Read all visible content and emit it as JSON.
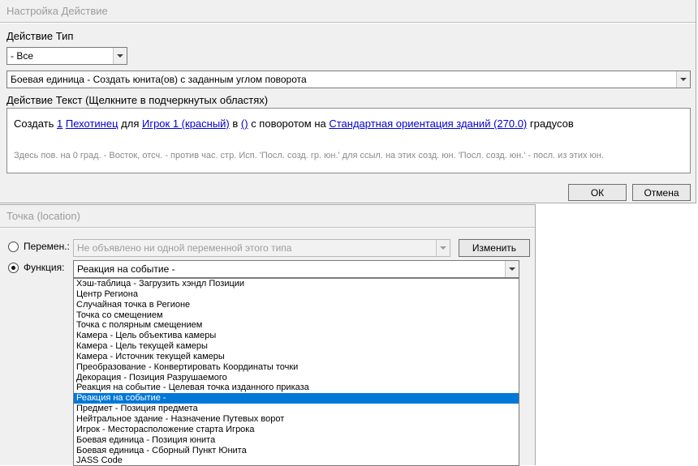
{
  "colors": {
    "selection": "#0078d7",
    "link": "#0000d4",
    "dialog_bg": "#f0f0f0"
  },
  "dialog_action": {
    "title": "Настройка Действие",
    "action_type_label": "Действие Тип",
    "filter_combo_value": "- Все",
    "action_combo_value": "Боевая единица - Создать юнита(ов) с заданным углом поворота",
    "action_text_label": "Действие Текст (Щелкните в подчеркнутых областях)",
    "action_text_segments": [
      {
        "text": "Создать ",
        "link": false
      },
      {
        "text": "1",
        "link": true
      },
      {
        "text": " ",
        "link": false
      },
      {
        "text": "Пехотинец",
        "link": true
      },
      {
        "text": " для ",
        "link": false
      },
      {
        "text": "Игрок 1 (красный)",
        "link": true
      },
      {
        "text": " в ",
        "link": false
      },
      {
        "text": "()",
        "link": true
      },
      {
        "text": " с поворотом на ",
        "link": false
      },
      {
        "text": "Стандартная ориентация зданий (270.0)",
        "link": true
      },
      {
        "text": " градусов",
        "link": false
      }
    ],
    "hint": "Здесь пов. на 0 град. - Восток, отсч. - против час. стр. Исп. 'Посл. созд. гр. юн.' для ссыл. на этих созд. юн. 'Посл. созд. юн.' - посл. из этих юн.",
    "ok_label": "ОК",
    "cancel_label": "Отмена"
  },
  "dialog_point": {
    "title": "Точка (location)",
    "variable_label": "Перемен.:",
    "variable_combo_value": "Не объявлено ни одной переменной этого типа",
    "edit_button_label": "Изменить",
    "function_label": "Функция:",
    "function_combo_value": "Реакция на событие -",
    "selected_index": 11,
    "list_items": [
      "Хэш-таблица - Загрузить хэндл Позиции",
      "Центр Региона",
      "Случайная точка в Регионе",
      "Точка со смещением",
      "Точка с полярным смещением",
      "Камера - Цель объектива камеры",
      "Камера - Цель текущей камеры",
      "Камера - Источник текущей камеры",
      "Преобразование - Конвертировать Координаты точки",
      "Декорация - Позиция Разрушаемого",
      "Реакция на событие - Целевая точка изданного приказа",
      "Реакция на событие -",
      "Предмет - Позиция предмета",
      "Нейтральное здание - Назначение Путевых ворот",
      "Игрок - Месторасположение старта Игрока",
      "Боевая единица - Позиция юнита",
      "Боевая единица - Сборный Пункт Юнита",
      "JASS Code"
    ]
  }
}
